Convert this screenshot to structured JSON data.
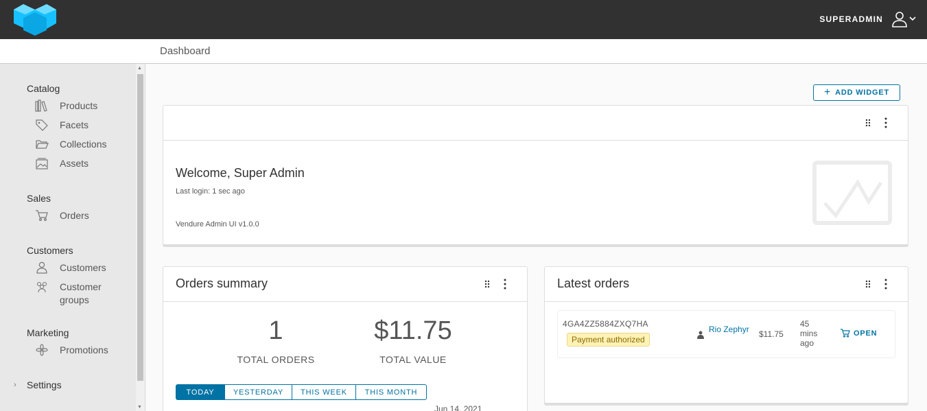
{
  "header": {
    "logo_icon": "vendure-cube-logo",
    "user_name": "SUPERADMIN",
    "user_icon": "user-icon"
  },
  "breadcrumb": {
    "current": "Dashboard"
  },
  "sidebar": {
    "sections": [
      {
        "title": "Catalog",
        "items": [
          {
            "label": "Products",
            "icon": "library-icon"
          },
          {
            "label": "Facets",
            "icon": "tag-icon"
          },
          {
            "label": "Collections",
            "icon": "folder-open-icon"
          },
          {
            "label": "Assets",
            "icon": "image-gallery-icon"
          }
        ]
      },
      {
        "title": "Sales",
        "items": [
          {
            "label": "Orders",
            "icon": "shopping-cart-icon"
          }
        ]
      },
      {
        "title": "Customers",
        "items": [
          {
            "label": "Customers",
            "icon": "user-icon"
          },
          {
            "label": "Customer groups",
            "icon": "users-icon"
          }
        ]
      },
      {
        "title": "Marketing",
        "items": [
          {
            "label": "Promotions",
            "icon": "asterisk-icon"
          }
        ]
      },
      {
        "title": "Settings",
        "items": []
      }
    ]
  },
  "toolbar": {
    "add_widget_label": "ADD WIDGET"
  },
  "welcome_widget": {
    "title": "Welcome, Super Admin",
    "last_login": "Last login: 1 sec ago",
    "version": "Vendure Admin UI v1.0.0",
    "image_icon": "line-chart-placeholder-icon"
  },
  "orders_summary": {
    "title": "Orders summary",
    "total_orders": "1",
    "total_orders_label": "TOTAL ORDERS",
    "total_value": "$11.75",
    "total_value_label": "TOTAL VALUE",
    "tabs": [
      "TODAY",
      "YESTERDAY",
      "THIS WEEK",
      "THIS MONTH"
    ],
    "active_tab": 0,
    "date_label": "Jun 14, 2021"
  },
  "latest_orders": {
    "title": "Latest orders",
    "orders": [
      {
        "code": "4GA4ZZ5884ZXQ7HA",
        "state": "Payment authorized",
        "customer": "Rio Zephyr",
        "total": "$11.75",
        "time": "45 mins ago",
        "open_label": "OPEN"
      }
    ]
  },
  "colors": {
    "header_bg": "#313131",
    "primary": "#0072a3",
    "logo": "#17c1ff",
    "badge_bg": "#fef3b5"
  }
}
